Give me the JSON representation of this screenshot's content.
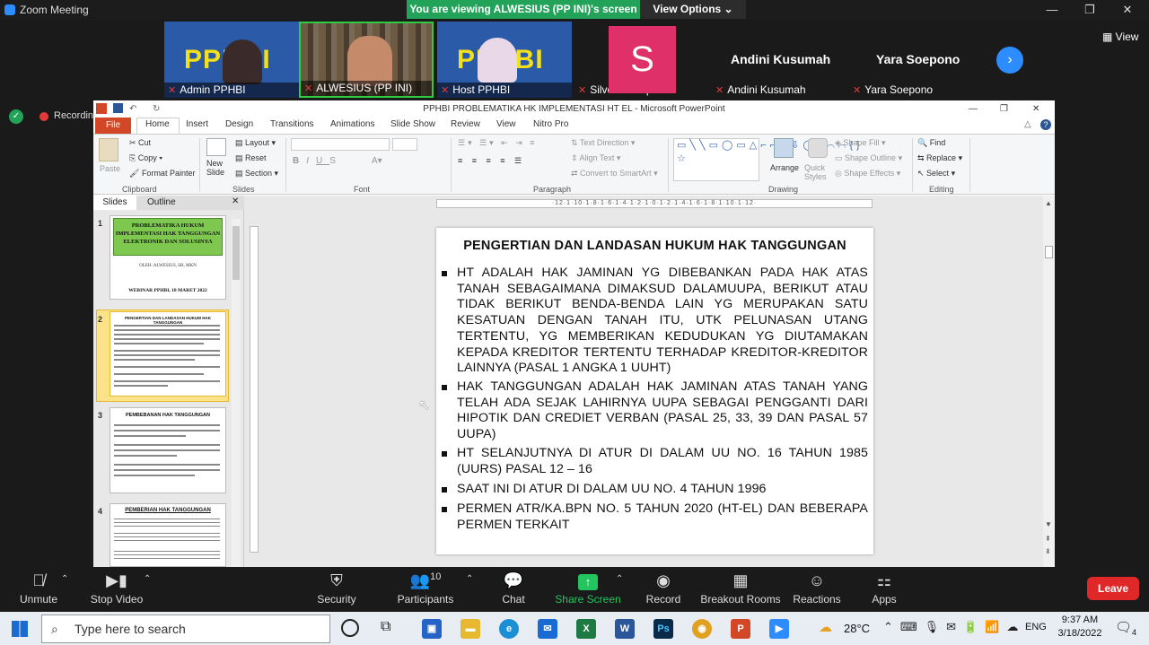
{
  "zoom": {
    "window_title": "Zoom Meeting",
    "viewing_banner": "You are viewing ALWESIUS (PP INI)'s screen",
    "view_options": "View Options",
    "view_button": "View",
    "recording": "Recording",
    "participants": [
      {
        "name": "Admin PPHBI"
      },
      {
        "name": "ALWESIUS (PP INI)"
      },
      {
        "name": "Host PPHBI"
      },
      {
        "name": "Silvester Yopie",
        "initial": "S"
      },
      {
        "name": "Andini Kusumah"
      },
      {
        "name": "Yara Soepono"
      }
    ],
    "tile_logo": "PPHBI",
    "toolbar": {
      "unmute": "Unmute",
      "stop_video": "Stop Video",
      "security": "Security",
      "participants": "Participants",
      "participants_count": "10",
      "chat": "Chat",
      "share_screen": "Share Screen",
      "record": "Record",
      "breakout_rooms": "Breakout Rooms",
      "reactions": "Reactions",
      "apps": "Apps",
      "leave": "Leave"
    }
  },
  "ppt": {
    "title": "PPHBI PROBLEMATIKA HK IMPLEMENTASI HT EL  -  Microsoft PowerPoint",
    "tabs": [
      "File",
      "Home",
      "Insert",
      "Design",
      "Transitions",
      "Animations",
      "Slide Show",
      "Review",
      "View",
      "Nitro Pro"
    ],
    "ribbon": {
      "cut": "Cut",
      "copy": "Copy",
      "format_painter": "Format Painter",
      "paste": "Paste",
      "clipboard": "Clipboard",
      "new_slide": "New Slide",
      "layout": "Layout",
      "reset": "Reset",
      "section": "Section",
      "slides": "Slides",
      "font": "Font",
      "paragraph": "Paragraph",
      "text_direction": "Text Direction",
      "align_text": "Align Text",
      "convert_smartart": "Convert to SmartArt",
      "arrange": "Arrange",
      "quick_styles": "Quick Styles",
      "shape_fill": "Shape Fill",
      "shape_outline": "Shape Outline",
      "shape_effects": "Shape Effects",
      "drawing": "Drawing",
      "find": "Find",
      "replace": "Replace",
      "select": "Select",
      "editing": "Editing"
    },
    "panel_tabs": [
      "Slides",
      "Outline"
    ],
    "thumbs": [
      {
        "num": "1",
        "title": "PROBLEMATIKA HUKUM IMPLEMENTASI HAK TANGGUNGAN ELEKTRONIK DAN SOLUSINYA",
        "author": "OLEH: ALWESIUS, SH, MKN",
        "footer": "WEBINAR PPHBI, 18 MARET 2022"
      },
      {
        "num": "2",
        "title": "PENGERTIAN DAN LANDASAN HUKUM HAK TANGGUNGAN"
      },
      {
        "num": "3",
        "title": "PEMBEBANAN HAK TANGGUNGAN"
      },
      {
        "num": "4",
        "title": "PEMBERIAN HAK TANGGUNGAN"
      }
    ],
    "ruler": "·12·1·10·1·8·1·6·1·4·1·2·1·0·1·2·1·4·1·6·1·8·1·10·1·12·",
    "slide": {
      "title": "PENGERTIAN DAN LANDASAN HUKUM HAK TANGGUNGAN",
      "bullets": [
        "HT ADALAH HAK JAMINAN YG DIBEBANKAN PADA HAK ATAS TANAH SEBAGAIMANA DIMAKSUD DALAMUUPA, BERIKUT ATAU TIDAK BERIKUT BENDA-BENDA LAIN YG MERUPAKAN SATU KESATUAN DENGAN  TANAH ITU, UTK PELUNASAN UTANG TERTENTU, YG MEMBERIKAN KEDUDUKAN YG DIUTAMAKAN KEPADA KREDITOR TERTENTU  TERHADAP KREDITOR-KREDITOR LAINNYA (PASAL 1 ANGKA 1 UUHT)",
        " HAK TANGGUNGAN ADALAH HAK JAMINAN ATAS TANAH YANG TELAH ADA SEJAK LAHIRNYA UUPA SEBAGAI PENGGANTI DARI HIPOTIK DAN CREDIET VERBAN (PASAL 25, 33, 39 DAN PASAL  57 UUPA)",
        "HT SELANJUTNYA  DI ATUR DI DALAM UU NO. 16 TAHUN 1985 (UURS) PASAL 12 – 16",
        "SAAT INI DI ATUR DI DALAM UU NO. 4 TAHUN 1996",
        "PERMEN ATR/KA.BPN NO. 5 TAHUN 2020 (HT-EL) DAN BEBERAPA PERMEN TERKAIT"
      ]
    }
  },
  "taskbar": {
    "search_placeholder": "Type here to search",
    "temperature": "28°C",
    "language": "ENG",
    "time": "9:37 AM",
    "date": "3/18/2022",
    "notifications": "4"
  }
}
